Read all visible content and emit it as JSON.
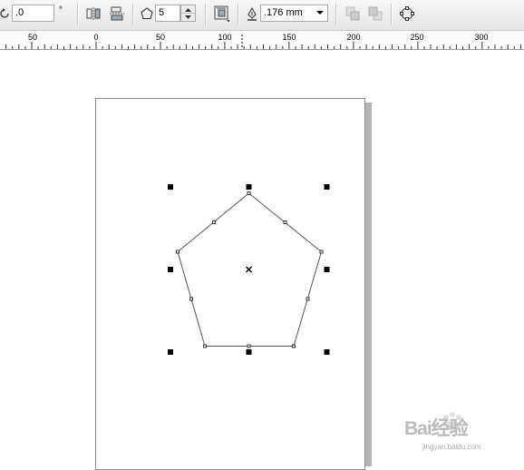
{
  "toolbar": {
    "rotation_value": ".0",
    "rotation_unit": "°",
    "polygon_sides": "5",
    "outline_width": ".176 mm"
  },
  "ruler": {
    "labels": [
      "50",
      "0",
      "50",
      "100",
      "150",
      "200",
      "250",
      "300"
    ]
  },
  "watermark": {
    "logo": "Bai经验",
    "url": "jingyan.baidu.com"
  },
  "colors": {
    "toolbar_bg": "#eeeeee",
    "page_shadow": "#b4b4b4",
    "handle": "#000000",
    "outline": "#555555"
  },
  "icons": [
    "rotate-icon",
    "mirror-horizontal-icon",
    "mirror-vertical-icon",
    "polygon-icon",
    "wrap-text-icon",
    "pen-outline-icon",
    "to-front-icon",
    "to-back-icon",
    "convert-to-curves-icon"
  ]
}
